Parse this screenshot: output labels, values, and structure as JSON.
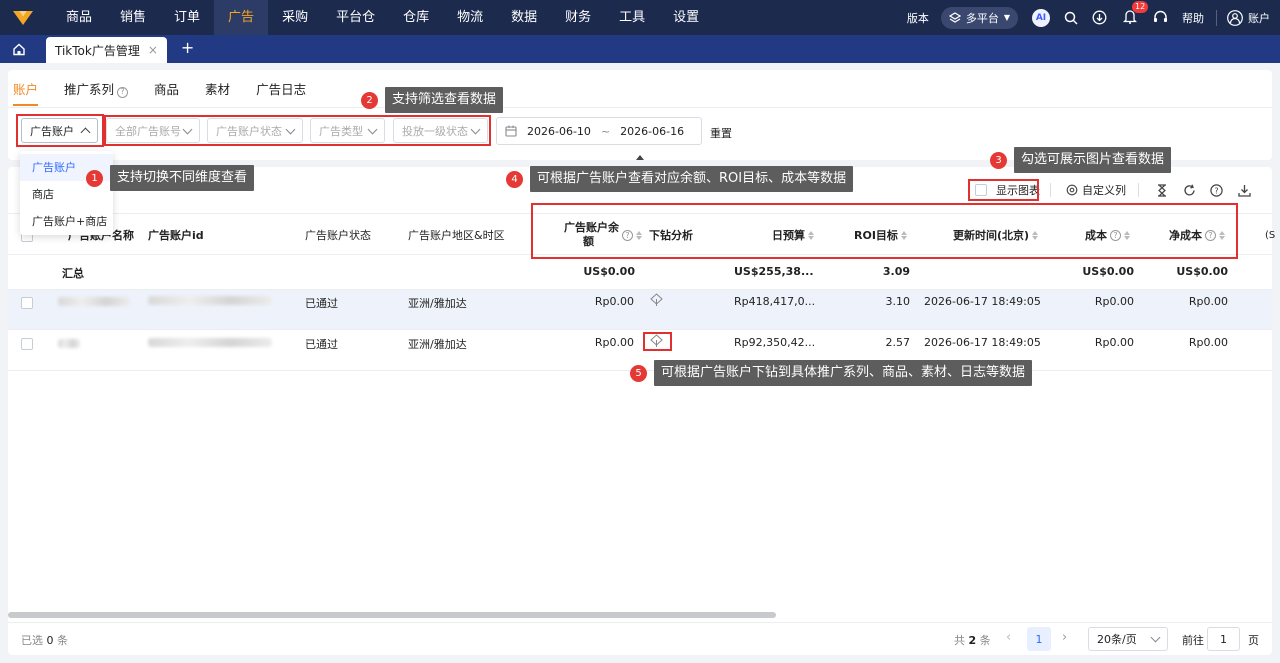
{
  "topnav": {
    "items": [
      "商品",
      "销售",
      "订单",
      "广告",
      "采购",
      "平台仓",
      "仓库",
      "物流",
      "数据",
      "财务",
      "工具",
      "设置"
    ],
    "active_index": 3,
    "version_label": "版本",
    "platform_label": "多平台",
    "ai_label": "AI",
    "notification_count": "12",
    "help_label": "帮助",
    "account_label": "账户"
  },
  "tabbar": {
    "page_tab_label": "TikTok广告管理",
    "add_tab": "+",
    "close": "×"
  },
  "subtabs": {
    "items": [
      "账户",
      "推广系列",
      "商品",
      "素材",
      "广告日志"
    ],
    "active_index": 0
  },
  "filters": {
    "dimension": "广告账户",
    "account": "全部广告账号",
    "status": "广告账户状态",
    "type": "广告类型",
    "delivery": "投放一级状态",
    "date_start": "2026-06-10",
    "date_sep": "~",
    "date_end": "2026-06-16",
    "reset": "重置"
  },
  "dropdown": {
    "items": [
      "广告账户",
      "商店",
      "广告账户+商店"
    ],
    "active_index": 0
  },
  "tips": [
    {
      "num": "1",
      "text": "支持切换不同维度查看"
    },
    {
      "num": "2",
      "text": "支持筛选查看数据"
    },
    {
      "num": "3",
      "text": "勾选可展示图片查看数据"
    },
    {
      "num": "4",
      "text": "可根据广告账户查看对应余额、ROI目标、成本等数据"
    },
    {
      "num": "5",
      "text": "可根据广告账户下钻到具体推广系列、商品、素材、日志等数据"
    }
  ],
  "toolbar": {
    "show_chart": "显示图表",
    "custom_columns": "自定义列"
  },
  "table": {
    "headers": {
      "name": "广告账户名称",
      "id": "广告账户id",
      "status": "广告账户状态",
      "region": "广告账户地区&时区",
      "balance_l1": "广告账户余",
      "balance_l2": "额",
      "drill": "下钻分析",
      "budget": "日预算",
      "roi": "ROI目标",
      "updated": "更新时间(北京)",
      "cost": "成本",
      "net_cost": "净成本",
      "extra": "(S"
    },
    "summary": {
      "label": "汇总",
      "balance": "US$0.00",
      "budget": "US$255,38...",
      "roi": "3.09",
      "cost": "US$0.00",
      "net_cost": "US$0.00"
    },
    "rows": [
      {
        "status": "已通过",
        "region": "亚洲/雅加达",
        "balance": "Rp0.00",
        "budget": "Rp418,417,0...",
        "roi": "3.10",
        "updated": "2026-06-17 18:49:05",
        "cost": "Rp0.00",
        "net_cost": "Rp0.00"
      },
      {
        "status": "已通过",
        "region": "亚洲/雅加达",
        "balance": "Rp0.00",
        "budget": "Rp92,350,42...",
        "roi": "2.57",
        "updated": "2026-06-17 18:49:05",
        "cost": "Rp0.00",
        "net_cost": "Rp0.00"
      }
    ]
  },
  "footer": {
    "selected_prefix": "已选",
    "selected_count": "0",
    "selected_suffix": "条",
    "total_prefix": "共",
    "total_count": "2",
    "total_suffix": "条",
    "current_page": "1",
    "page_size": "20条/页",
    "goto_label": "前往",
    "goto_value": "1",
    "page_suffix": "页"
  },
  "colors": {
    "nav_bg": "#1c2a4e",
    "tab_bg": "#223a84",
    "accent": "#f08a24",
    "highlight_border": "#e03030",
    "link": "#2f6bff"
  }
}
